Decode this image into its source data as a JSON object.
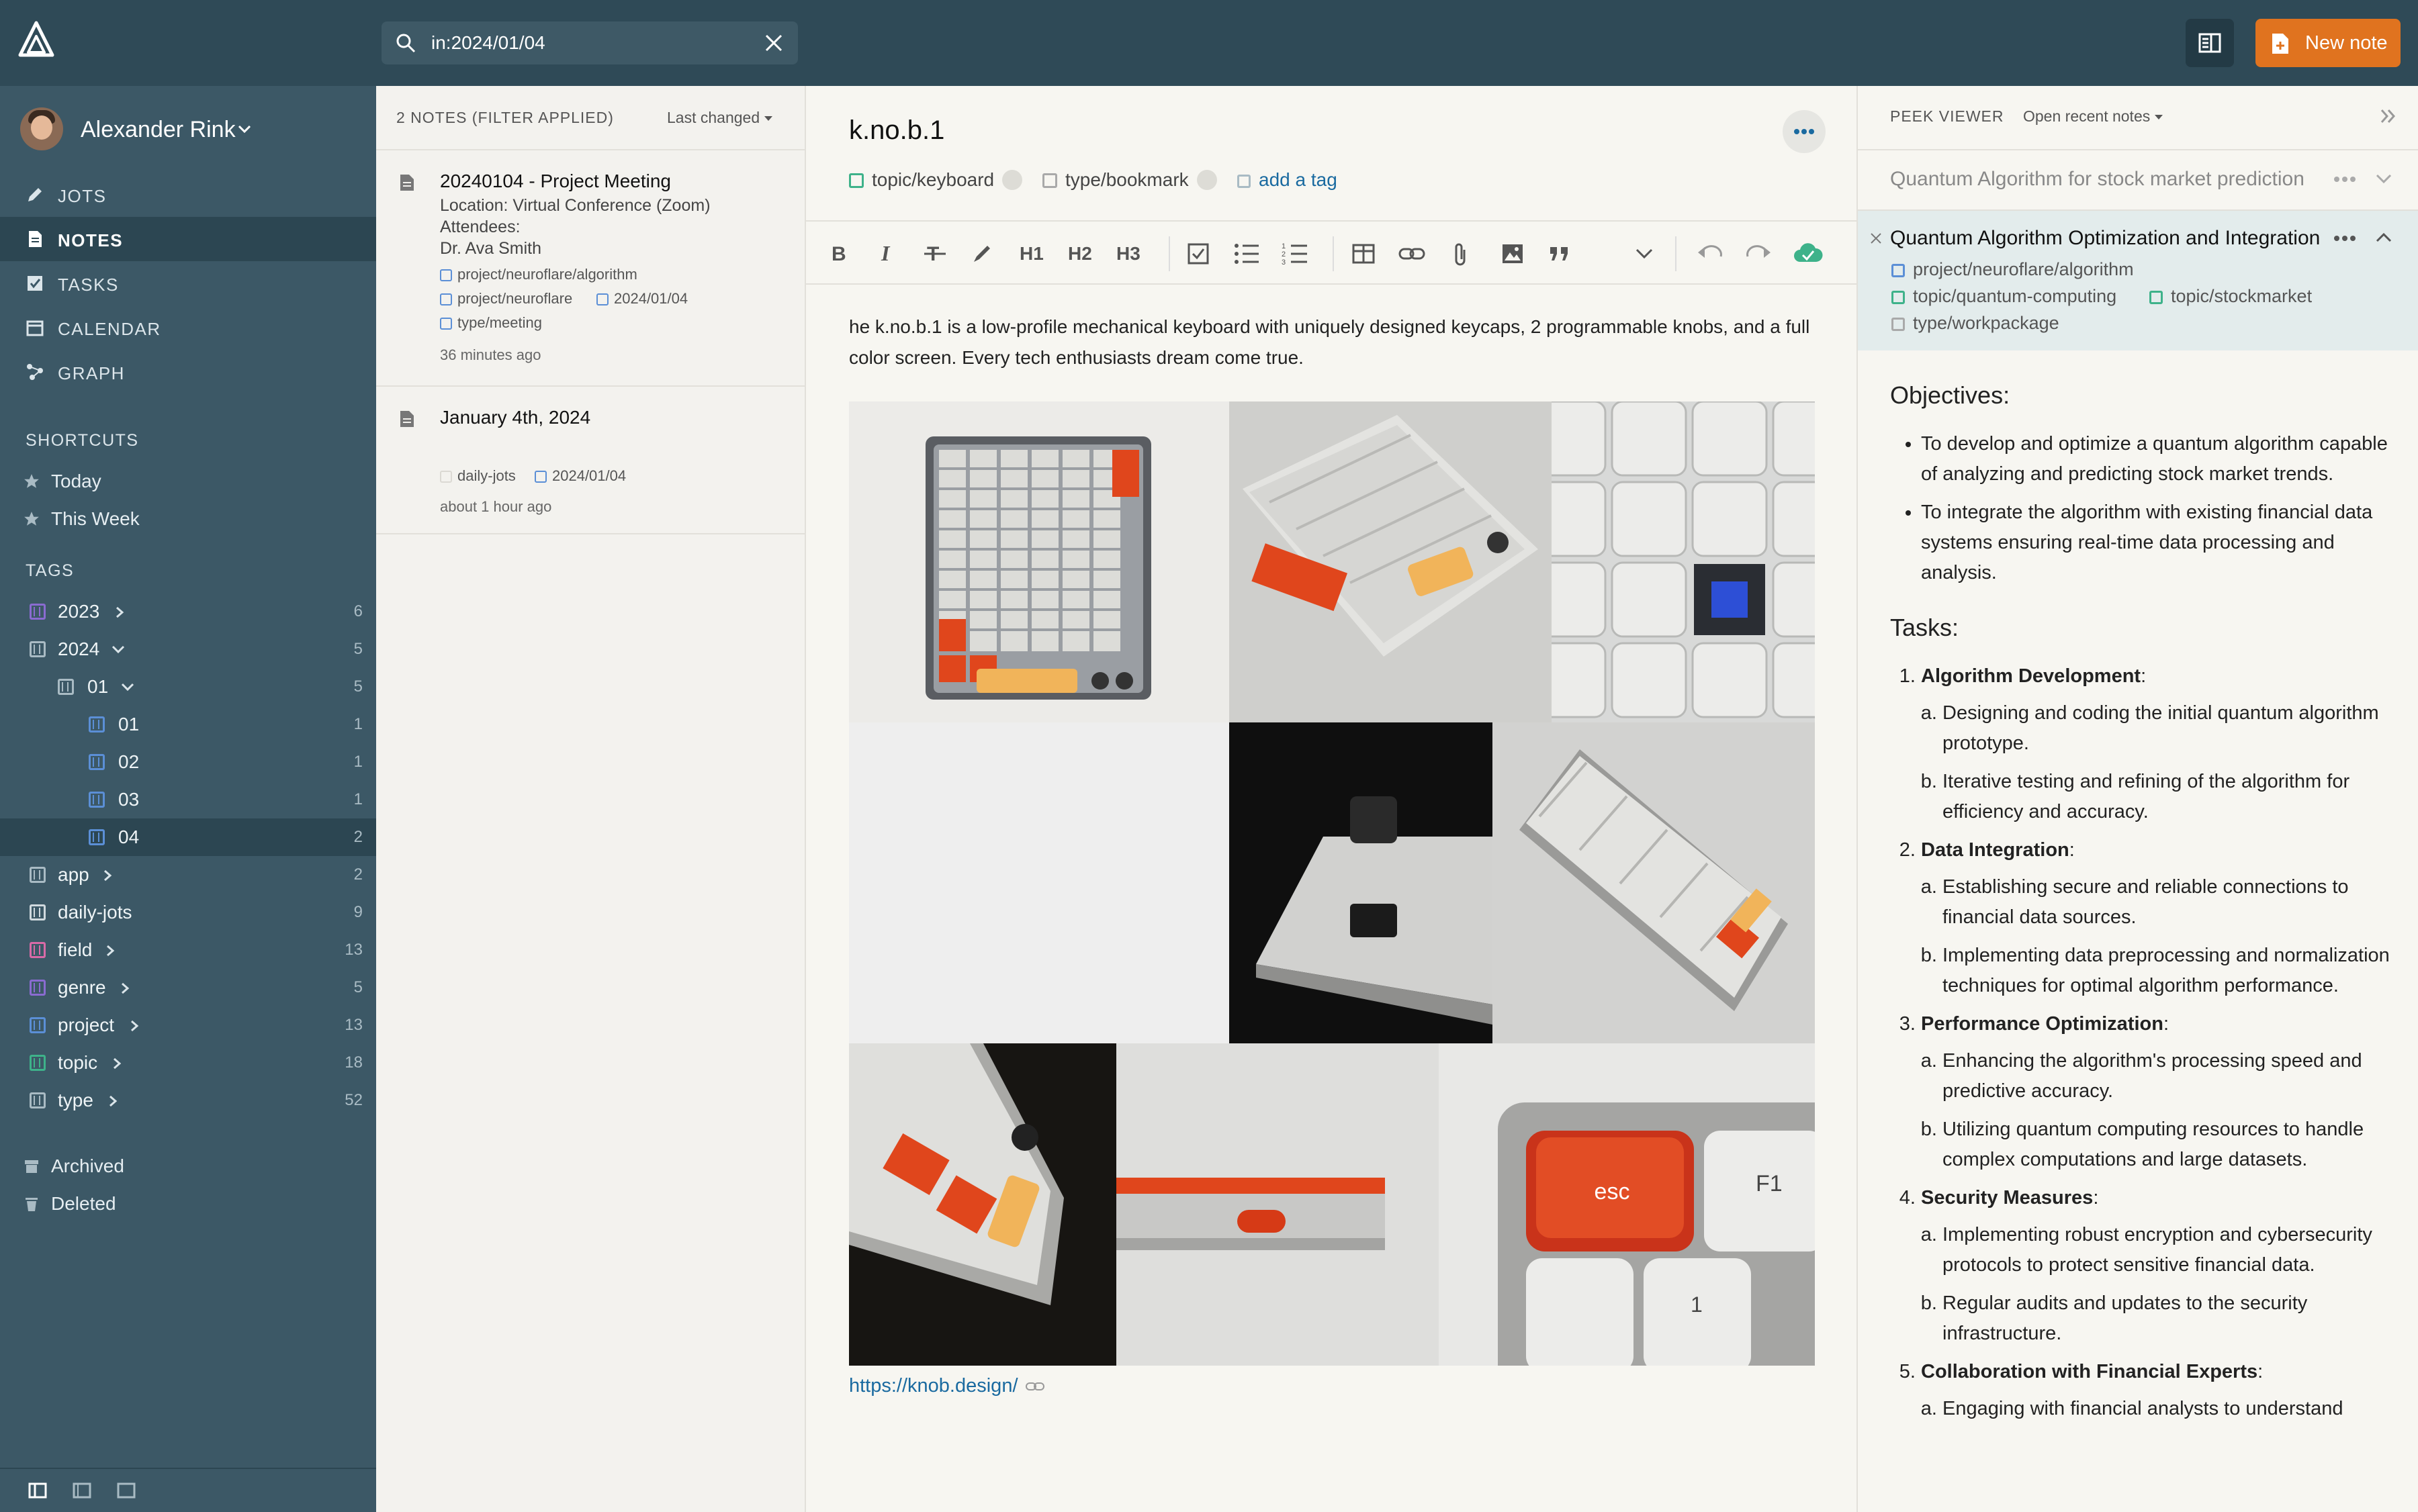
{
  "search": {
    "value": "in:2024/01/04"
  },
  "header": {
    "new_note_label": "New note"
  },
  "user": {
    "name": "Alexander Rink"
  },
  "nav": [
    "JOTS",
    "NOTES",
    "TASKS",
    "CALENDAR",
    "GRAPH"
  ],
  "shortcuts": {
    "heading": "SHORTCUTS",
    "items": [
      "Today",
      "This Week"
    ]
  },
  "tags": {
    "heading": "TAGS",
    "items": [
      {
        "label": "2023",
        "count": "6"
      },
      {
        "label": "2024",
        "count": "5"
      },
      {
        "label": "01",
        "count": "5"
      },
      {
        "label": "01",
        "count": "1"
      },
      {
        "label": "02",
        "count": "1"
      },
      {
        "label": "03",
        "count": "1"
      },
      {
        "label": "04",
        "count": "2"
      },
      {
        "label": "app",
        "count": "2"
      },
      {
        "label": "daily-jots",
        "count": "9"
      },
      {
        "label": "field",
        "count": "13"
      },
      {
        "label": "genre",
        "count": "5"
      },
      {
        "label": "project",
        "count": "13"
      },
      {
        "label": "topic",
        "count": "18"
      },
      {
        "label": "type",
        "count": "52"
      }
    ]
  },
  "archived_label": "Archived",
  "deleted_label": "Deleted",
  "notes_list": {
    "header": "2 NOTES (FILTER APPLIED)",
    "sort": "Last changed",
    "items": [
      {
        "title": "20240104 - Project Meeting",
        "preview": [
          "Location: Virtual Conference (Zoom)",
          "Attendees:",
          "Dr. Ava Smith"
        ],
        "tags": [
          "project/neuroflare/algorithm",
          "project/neuroflare",
          "2024/01/04",
          "type/meeting"
        ],
        "ago": "36 minutes ago"
      },
      {
        "title": "January 4th, 2024",
        "tags": [
          "daily-jots",
          "2024/01/04"
        ],
        "ago": "about 1 hour ago"
      }
    ]
  },
  "editor": {
    "title": "k.no.b.1",
    "tags": [
      "topic/keyboard",
      "type/bookmark"
    ],
    "add_tag": "add a tag",
    "toolbar": {
      "h1": "H1",
      "h2": "H2",
      "h3": "H3"
    },
    "body": "he k.no.b.1 is a low-profile mechanical keyboard with uniquely designed keycaps, 2 programmable knobs, and a full color screen. Every tech enthusiasts dream come true.",
    "link": "https://knob.design/",
    "image_labels": {
      "esc": "esc",
      "f1": "F1",
      "one": "1"
    }
  },
  "peek": {
    "header": "PEEK VIEWER",
    "open_recent": "Open recent notes",
    "collapsed_note": "Quantum Algorithm for stock market prediction",
    "active_note": "Quantum Algorithm Optimization and Integration",
    "active_tags": [
      "project/neuroflare/algorithm",
      "topic/quantum-computing",
      "topic/stockmarket",
      "type/workpackage"
    ],
    "objectives_heading": "Objectives:",
    "objectives": [
      "To develop and optimize a quantum algorithm capable of analyzing and predicting stock market trends.",
      "To integrate the algorithm with existing financial data systems ensuring real-time data processing and analysis."
    ],
    "tasks_heading": "Tasks:",
    "tasks": [
      {
        "title": "Algorithm Development",
        "subs": [
          "Designing and coding the initial quantum algorithm prototype.",
          "Iterative testing and refining of the algorithm for efficiency and accuracy."
        ]
      },
      {
        "title": "Data Integration",
        "subs": [
          "Establishing secure and reliable connections to financial data sources.",
          "Implementing data preprocessing and normalization techniques for optimal algorithm performance."
        ]
      },
      {
        "title": "Performance Optimization",
        "subs": [
          "Enhancing the algorithm's processing speed and predictive accuracy.",
          "Utilizing quantum computing resources to handle complex computations and large datasets."
        ]
      },
      {
        "title": "Security Measures",
        "subs": [
          "Implementing robust encryption and cybersecurity protocols to protect sensitive financial data.",
          "Regular audits and updates to the security infrastructure."
        ]
      },
      {
        "title": "Collaboration with Financial Experts",
        "subs": [
          "Engaging with financial analysts to understand"
        ]
      }
    ]
  },
  "colors": {
    "topbar": "#2f4a57",
    "sidebar": "#3c5866",
    "accent": "#e0731f",
    "link": "#1a6aa0",
    "tag_green": "#3eb28a",
    "tag_blue": "#5b8fd6",
    "tag_purple": "#8a6bd1",
    "tag_pink": "#d96aa7"
  }
}
